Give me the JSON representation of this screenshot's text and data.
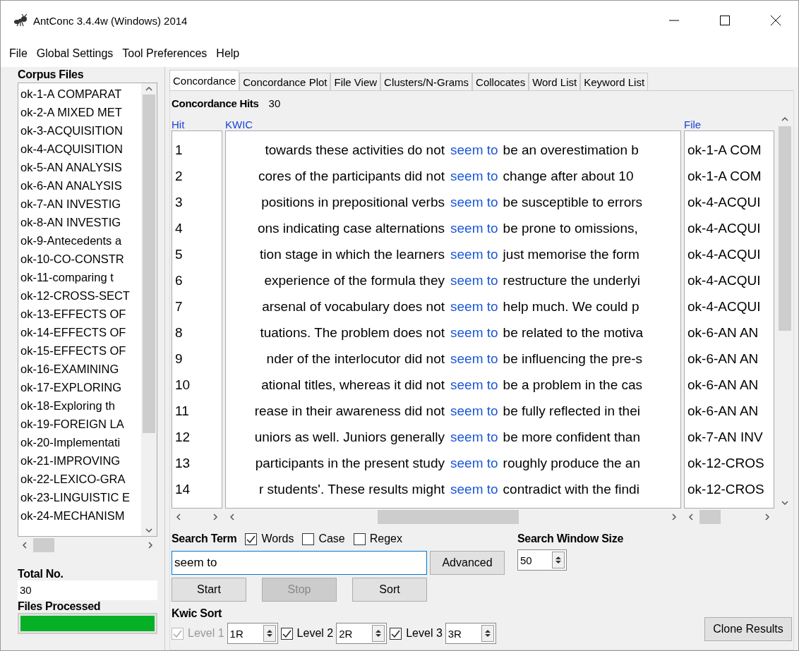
{
  "window": {
    "title": "AntConc 3.4.4w (Windows) 2014"
  },
  "menu": [
    "File",
    "Global Settings",
    "Tool Preferences",
    "Help"
  ],
  "corpus": {
    "heading": "Corpus Files",
    "files": [
      "ok-1-A COMPARAT",
      "ok-2-A MIXED MET",
      "ok-3-ACQUISITION",
      "ok-4-ACQUISITION",
      "ok-5-AN ANALYSIS",
      "ok-6-AN ANALYSIS",
      "ok-7-AN INVESTIG",
      "ok-8-AN INVESTIG",
      "ok-9-Antecedents a",
      "ok-10-CO-CONSTR",
      "ok-11-comparing t",
      "ok-12-CROSS-SECT",
      "ok-13-EFFECTS OF",
      "ok-14-EFFECTS OF",
      "ok-15-EFFECTS OF",
      "ok-16-EXAMINING",
      "ok-17-EXPLORING",
      "ok-18-Exploring th",
      "ok-19-FOREIGN LA",
      "ok-20-Implementati",
      "ok-21-IMPROVING",
      "ok-22-LEXICO-GRA",
      "ok-23-LINGUISTIC E",
      "ok-24-MECHANISM"
    ],
    "total_label": "Total No.",
    "total": "30",
    "processed": {
      "label": "Files Processed",
      "level": 1
    }
  },
  "tabs": [
    {
      "label": "Concordance",
      "selected": true
    },
    {
      "label": "Concordance Plot",
      "selected": false
    },
    {
      "label": "File View",
      "selected": false
    },
    {
      "label": "Clusters/N-Grams",
      "selected": false
    },
    {
      "label": "Collocates",
      "selected": false
    },
    {
      "label": "Word List",
      "selected": false
    },
    {
      "label": "Keyword List",
      "selected": false
    }
  ],
  "hits": {
    "label": "Concordance Hits",
    "value": "30"
  },
  "table": {
    "columns": [
      "Hit",
      "KWIC",
      "File"
    ],
    "rows": [
      {
        "hit": "1",
        "left": "towards these activities do not",
        "keyword": "seem to",
        "right": "be an overestimation b",
        "file": "ok-1-A COM"
      },
      {
        "hit": "2",
        "left": "cores of the participants did not",
        "keyword": "seem to",
        "right": "change after about 10",
        "file": "ok-1-A COM"
      },
      {
        "hit": "3",
        "left": "positions in prepositional verbs",
        "keyword": "seem to",
        "right": "be susceptible to errors",
        "file": "ok-4-ACQUI"
      },
      {
        "hit": "4",
        "left": "ons indicating case alternations",
        "keyword": "seem to",
        "right": "be prone to omissions,",
        "file": "ok-4-ACQUI"
      },
      {
        "hit": "5",
        "left": "tion stage in which the learners",
        "keyword": "seem to",
        "right": "just memorise the form",
        "file": "ok-4-ACQUI"
      },
      {
        "hit": "6",
        "left": "experience of the formula they",
        "keyword": "seem to",
        "right": "restructure the underlyi",
        "file": "ok-4-ACQUI"
      },
      {
        "hit": "7",
        "left": "arsenal of vocabulary does not",
        "keyword": "seem to",
        "right": "help much. We could p",
        "file": "ok-4-ACQUI"
      },
      {
        "hit": "8",
        "left": "tuations. The problem does not",
        "keyword": "seem to",
        "right": "be related to the motiva",
        "file": "ok-6-AN AN"
      },
      {
        "hit": "9",
        "left": "nder of the interlocutor did not",
        "keyword": "seem to",
        "right": "be influencing the pre-s",
        "file": "ok-6-AN AN"
      },
      {
        "hit": "10",
        "left": "ational titles, whereas it did not",
        "keyword": "seem to",
        "right": "be a problem in the cas",
        "file": "ok-6-AN AN"
      },
      {
        "hit": "11",
        "left": "rease in their awareness did not",
        "keyword": "seem to",
        "right": "be fully reflected in thei",
        "file": "ok-6-AN AN"
      },
      {
        "hit": "12",
        "left": "uniors as well. Juniors generally",
        "keyword": "seem to",
        "right": "be more confident than",
        "file": "ok-7-AN INV"
      },
      {
        "hit": "13",
        "left": "participants in the present study",
        "keyword": "seem to",
        "right": "roughly produce the an",
        "file": "ok-12-CROS"
      },
      {
        "hit": "14",
        "left": "r students'. These results might",
        "keyword": "seem to",
        "right": "contradict with the findi",
        "file": "ok-12-CROS"
      }
    ]
  },
  "search": {
    "label": "Search Term",
    "options": [
      {
        "label": "Words",
        "checked": true
      },
      {
        "label": "Case",
        "checked": false
      },
      {
        "label": "Regex",
        "checked": false
      }
    ],
    "value": "seem to",
    "advanced": "Advanced",
    "window_label": "Search Window Size",
    "window_size": "50"
  },
  "actions": [
    {
      "label": "Start",
      "disabled": false
    },
    {
      "label": "Stop",
      "disabled": true
    },
    {
      "label": "Sort",
      "disabled": false
    }
  ],
  "kwic_sort": {
    "label": "Kwic Sort",
    "levels": [
      {
        "label": "Level 1",
        "checked": true,
        "disabled": true,
        "value": "1R"
      },
      {
        "label": "Level 2",
        "checked": true,
        "disabled": false,
        "value": "2R"
      },
      {
        "label": "Level 3",
        "checked": true,
        "disabled": false,
        "value": "3R"
      }
    ]
  },
  "clone": "Clone Results"
}
